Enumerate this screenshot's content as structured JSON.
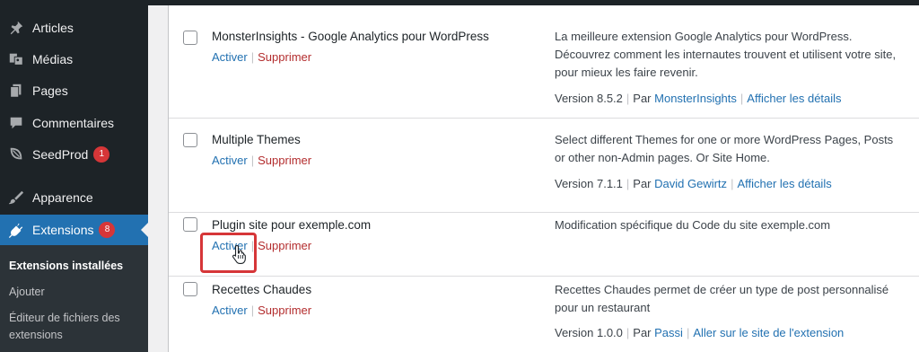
{
  "sidebar": {
    "items": [
      {
        "label": "Articles",
        "icon": "pushpin-icon"
      },
      {
        "label": "Médias",
        "icon": "media-icon"
      },
      {
        "label": "Pages",
        "icon": "pages-icon"
      },
      {
        "label": "Commentaires",
        "icon": "comment-icon"
      },
      {
        "label": "SeedProd",
        "icon": "seedprod-icon",
        "badge": "1"
      },
      {
        "label": "Apparence",
        "icon": "brush-icon"
      },
      {
        "label": "Extensions",
        "icon": "plugin-icon",
        "badge": "8",
        "active": true
      }
    ],
    "submenu": [
      {
        "label": "Extensions installées",
        "current": true
      },
      {
        "label": "Ajouter"
      },
      {
        "label": "Éditeur de fichiers des extensions"
      }
    ]
  },
  "plugins": [
    {
      "name": "MonsterInsights - Google Analytics pour WordPress",
      "activate": "Activer",
      "delete": "Supprimer",
      "description": "La meilleure extension Google Analytics pour WordPress. Découvrez comment les internautes trouvent et utilisent votre site, pour mieux les faire revenir.",
      "version": "Version 8.5.2",
      "by": "Par",
      "author": "MonsterInsights",
      "details": "Afficher les détails"
    },
    {
      "name": "Multiple Themes",
      "activate": "Activer",
      "delete": "Supprimer",
      "description": "Select different Themes for one or more WordPress Pages, Posts or other non-Admin pages. Or Site Home.",
      "version": "Version 7.1.1",
      "by": "Par",
      "author": "David Gewirtz",
      "details": "Afficher les détails"
    },
    {
      "name": "Plugin site pour exemple.com",
      "activate": "Activer",
      "delete": "Supprimer",
      "description": "Modification spécifique du Code du site exemple.com"
    },
    {
      "name": "Recettes Chaudes",
      "activate": "Activer",
      "delete": "Supprimer",
      "description": "Recettes Chaudes permet de créer un type de post personnalisé pour un restaurant",
      "version": "Version 1.0.0",
      "by": "Par",
      "author": "Passi",
      "details": "Aller sur le site de l'extension"
    }
  ],
  "colors": {
    "accent": "#2271b1",
    "delete": "#b32d2e",
    "highlight": "#d63638",
    "sidebar": "#1d2327"
  }
}
